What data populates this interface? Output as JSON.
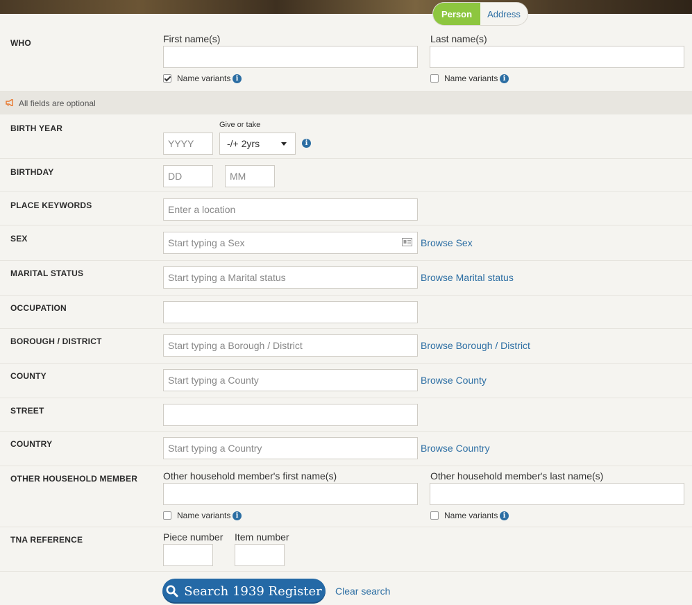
{
  "toggle": {
    "person": "Person",
    "address": "Address"
  },
  "who": {
    "label": "WHO",
    "first_label": "First name(s)",
    "last_label": "Last name(s)",
    "first_variants": {
      "label": "Name variants",
      "checked": true
    },
    "last_variants": {
      "label": "Name variants",
      "checked": false
    }
  },
  "optional_note": "All fields are optional",
  "birth_year": {
    "label": "BIRTH YEAR",
    "placeholder": "YYYY",
    "give_or_take_label": "Give or take",
    "give_or_take_value": "-/+ 2yrs"
  },
  "birthday": {
    "label": "BIRTHDAY",
    "day_placeholder": "DD",
    "month_placeholder": "MM"
  },
  "place_keywords": {
    "label": "PLACE KEYWORDS",
    "placeholder": "Enter a location"
  },
  "sex": {
    "label": "SEX",
    "placeholder": "Start typing a Sex",
    "browse": "Browse Sex"
  },
  "marital_status": {
    "label": "MARITAL STATUS",
    "placeholder": "Start typing a Marital status",
    "browse": "Browse Marital status"
  },
  "occupation": {
    "label": "OCCUPATION"
  },
  "borough": {
    "label": "BOROUGH / DISTRICT",
    "placeholder": "Start typing a Borough / District",
    "browse": "Browse Borough / District"
  },
  "county": {
    "label": "COUNTY",
    "placeholder": "Start typing a County",
    "browse": "Browse County"
  },
  "street": {
    "label": "STREET"
  },
  "country": {
    "label": "COUNTRY",
    "placeholder": "Start typing a Country",
    "browse": "Browse Country"
  },
  "household": {
    "label": "OTHER HOUSEHOLD MEMBER",
    "first_label": "Other household member's first name(s)",
    "last_label": "Other household member's last name(s)",
    "first_variants": {
      "label": "Name variants",
      "checked": false
    },
    "last_variants": {
      "label": "Name variants",
      "checked": false
    }
  },
  "tna": {
    "label": "TNA REFERENCE",
    "piece_label": "Piece number",
    "item_label": "Item number"
  },
  "actions": {
    "search": "Search 1939 Register",
    "clear": "Clear search"
  },
  "colors": {
    "accent_green": "#8dc63f",
    "link_blue": "#2c6ea3",
    "button_blue": "#2469a6"
  }
}
